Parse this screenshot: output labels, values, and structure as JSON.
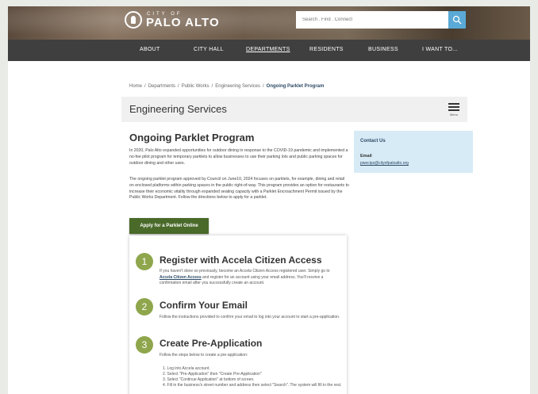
{
  "header": {
    "logo_small": "CITY OF",
    "logo_big": "PALO ALTO",
    "search_placeholder": "Search . Find . Connect"
  },
  "nav": {
    "items": [
      "ABOUT",
      "CITY HALL",
      "DEPARTMENTS",
      "RESIDENTS",
      "BUSINESS",
      "I WANT TO..."
    ],
    "current": "DEPARTMENTS"
  },
  "breadcrumb": {
    "items": [
      "Home",
      "Departments",
      "Public Works",
      "Engineering Services"
    ],
    "current": "Ongoing Parklet Program",
    "separator": "/"
  },
  "title_bar": {
    "title": "Engineering Services",
    "menu_label": "Menu"
  },
  "content": {
    "heading": "Ongoing Parklet Program",
    "para1": "In 2020, Palo Alto expanded opportunities for outdoor dining in response to the COVID-19 pandemic and implemented a no-fee pilot program for temporary parklets to allow businesses to use their parking lots and public parking spaces for outdoor dining and other uses.",
    "para2": "The ongoing parklet program approved by Council on June10, 2024 focuses on parklets, for example, dining and retail on enclosed platforms within parking spaces in the public right-of-way. This program provides an option for restaurants to increase their economic vitality through expanded seating capacity with a Parklet Encroachment Permit issued by the Public Works Department. Follow the directions below to apply for a parklet.",
    "apply_button": "Apply for a Parklet Online"
  },
  "steps": [
    {
      "number": "1",
      "title": "Register with Accela Citizen Access",
      "desc_before": "If you haven't done so previously, become an Accela Citizen Access registered user. Simply go to ",
      "desc_link": "Accela Citizen Access",
      "desc_after": " and register for an account using your email address. You'll receive a confirmation email after you successfully create an account."
    },
    {
      "number": "2",
      "title": "Confirm Your Email",
      "desc": "Follow the instructions provided to confirm your email to log into your account to start a pre-application."
    },
    {
      "number": "3",
      "title": "Create Pre-Application",
      "desc": "Follow the steps below to create a pre-application:",
      "list": [
        "1. Log into Accela account.",
        "2. Select \"Pre-Application\" then \"Create Pre-Application\"",
        "3. Select \"Continue Application\" at bottom of screen.",
        "4. Fill in the business's street number and address then select \"Search\". The system will fill in the rest."
      ]
    }
  ],
  "contact": {
    "title": "Contact Us",
    "email_label": "Email",
    "email": "pwecips@cityofpaloalto.org"
  },
  "colors": {
    "nav_bg": "#3f3f3f",
    "search_btn": "#5aa9d6",
    "apply_btn": "#4a6a2a",
    "step_circle": "#8fa64c",
    "contact_bg": "#d7ebf6"
  }
}
